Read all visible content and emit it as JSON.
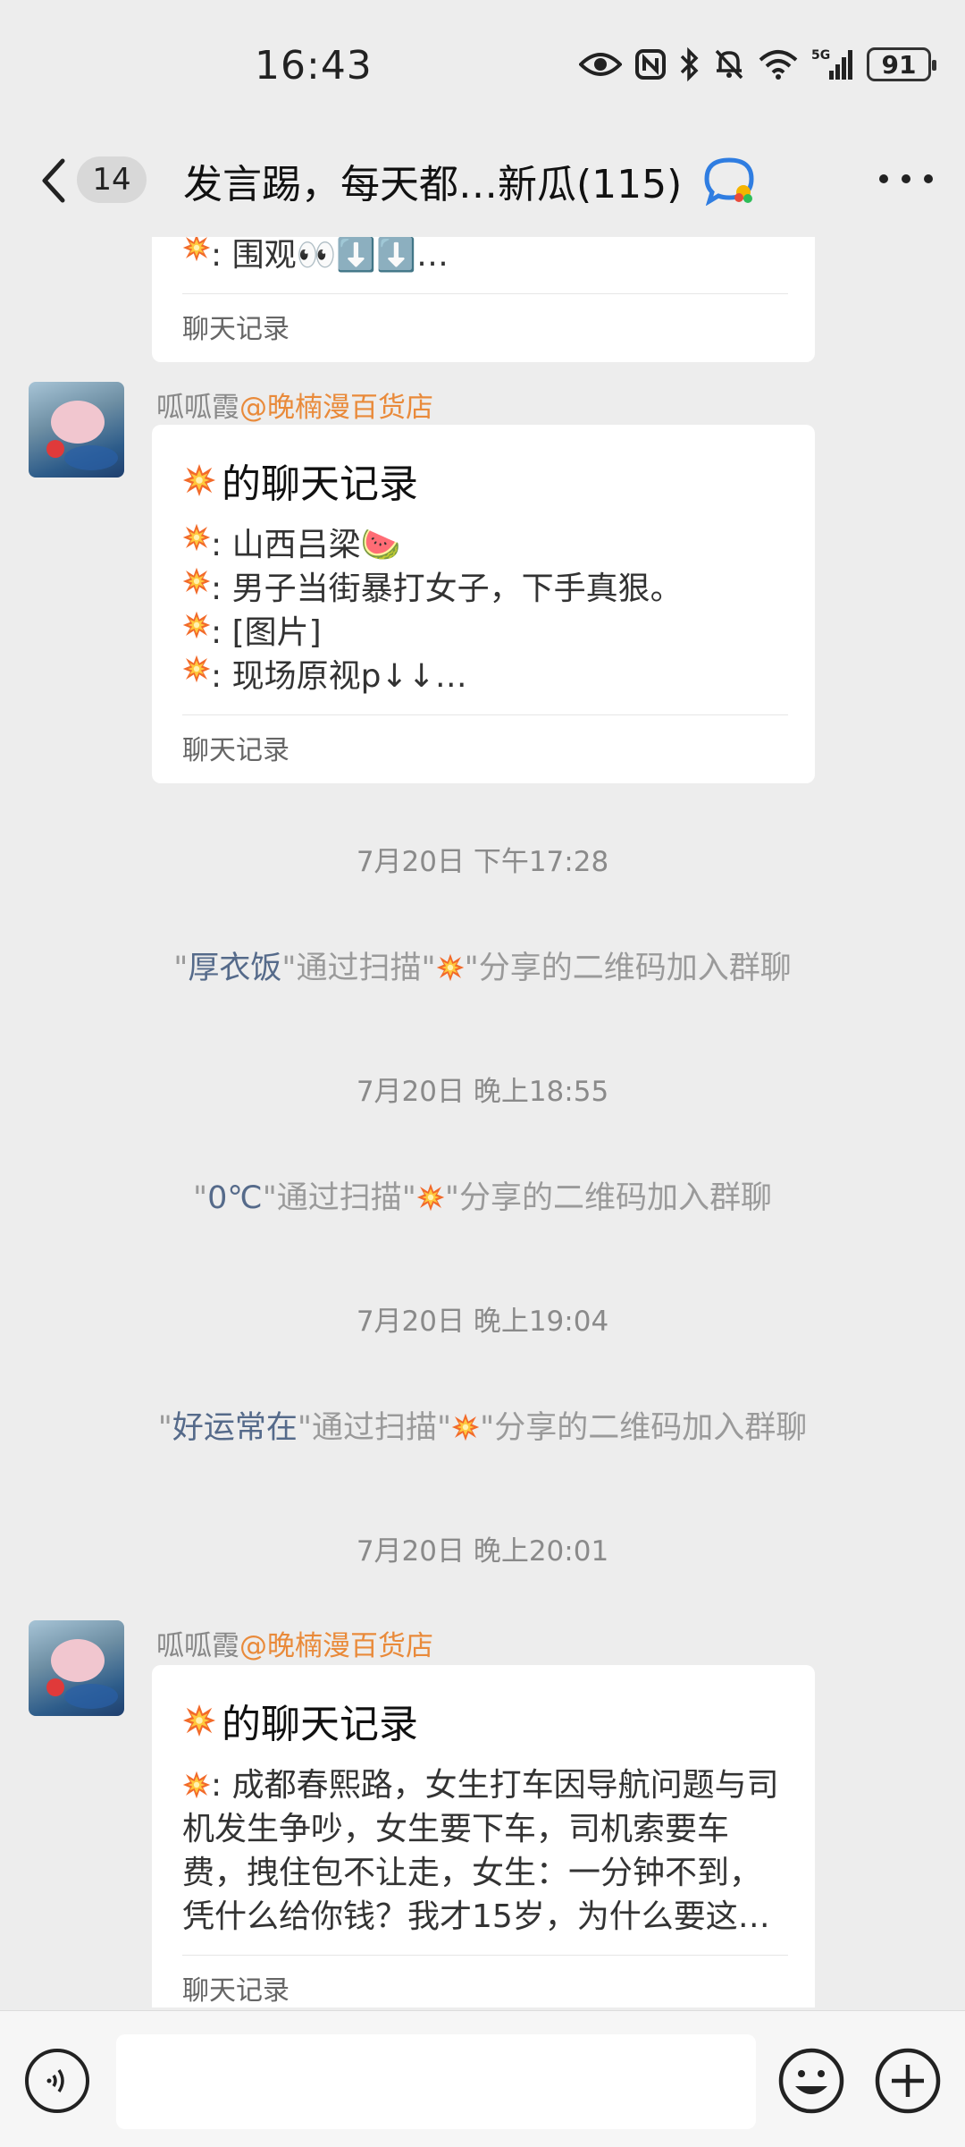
{
  "status_bar": {
    "time": "16:43",
    "signal_label": "5G",
    "battery": "91",
    "icons": [
      "eye-icon",
      "nfc-icon",
      "bluetooth-icon",
      "mute-bell-icon",
      "wifi-icon",
      "signal-icon",
      "battery-icon"
    ]
  },
  "header": {
    "unread_count": "14",
    "title": "发言踢，每天都…新瓜(115)",
    "back_icon": "chevron-left-icon",
    "badge_icon": "group-chat-bubble-icon",
    "more_icon": "more-dots-icon"
  },
  "messages": {
    "prev_card": {
      "line": ": 围观👀⬇️⬇️…",
      "footer": "聊天记录"
    },
    "card1": {
      "sender_name": "呱呱霞",
      "sender_group": "@晚楠漫百货店",
      "title": "的聊天记录",
      "lines": [
        ": 山西吕梁🍉",
        ": 男子当街暴打女子，下手真狠。",
        ": [图片]",
        ": 现场原视p↓↓…"
      ],
      "footer": "聊天记录"
    },
    "ts1": "7月20日 下午17:28",
    "join1": {
      "quote_open": "\"",
      "name": "厚衣饭",
      "mid": "\"通过扫描\"",
      "tail": "\"分享的二维码加入群聊"
    },
    "ts2": "7月20日 晚上18:55",
    "join2": {
      "quote_open": "\"",
      "name": "0℃",
      "mid": "\"通过扫描\"",
      "tail": "\"分享的二维码加入群聊"
    },
    "ts3": "7月20日 晚上19:04",
    "join3": {
      "quote_open": "\"",
      "name": "好运常在",
      "mid": "\"通过扫描\"",
      "tail": "\"分享的二维码加入群聊"
    },
    "ts4": "7月20日 晚上20:01",
    "card2": {
      "sender_name": "呱呱霞",
      "sender_group": "@晚楠漫百货店",
      "title": "的聊天记录",
      "line": ": 成都春熙路，女生打车因导航问题与司机发生争吵，女生要下车，司机索要车费，拽住包不让走，女生：一分钟不到，凭什么给你钱？我才15岁，为什么要这…",
      "footer": "聊天记录"
    }
  },
  "input_bar": {
    "voice_icon": "voice-icon",
    "emoji_icon": "emoji-icon",
    "plus_icon": "plus-icon",
    "placeholder": ""
  },
  "colors": {
    "background": "#ededed",
    "card": "#ffffff",
    "mention": "#e98a3a",
    "system_name": "#556a8a"
  }
}
